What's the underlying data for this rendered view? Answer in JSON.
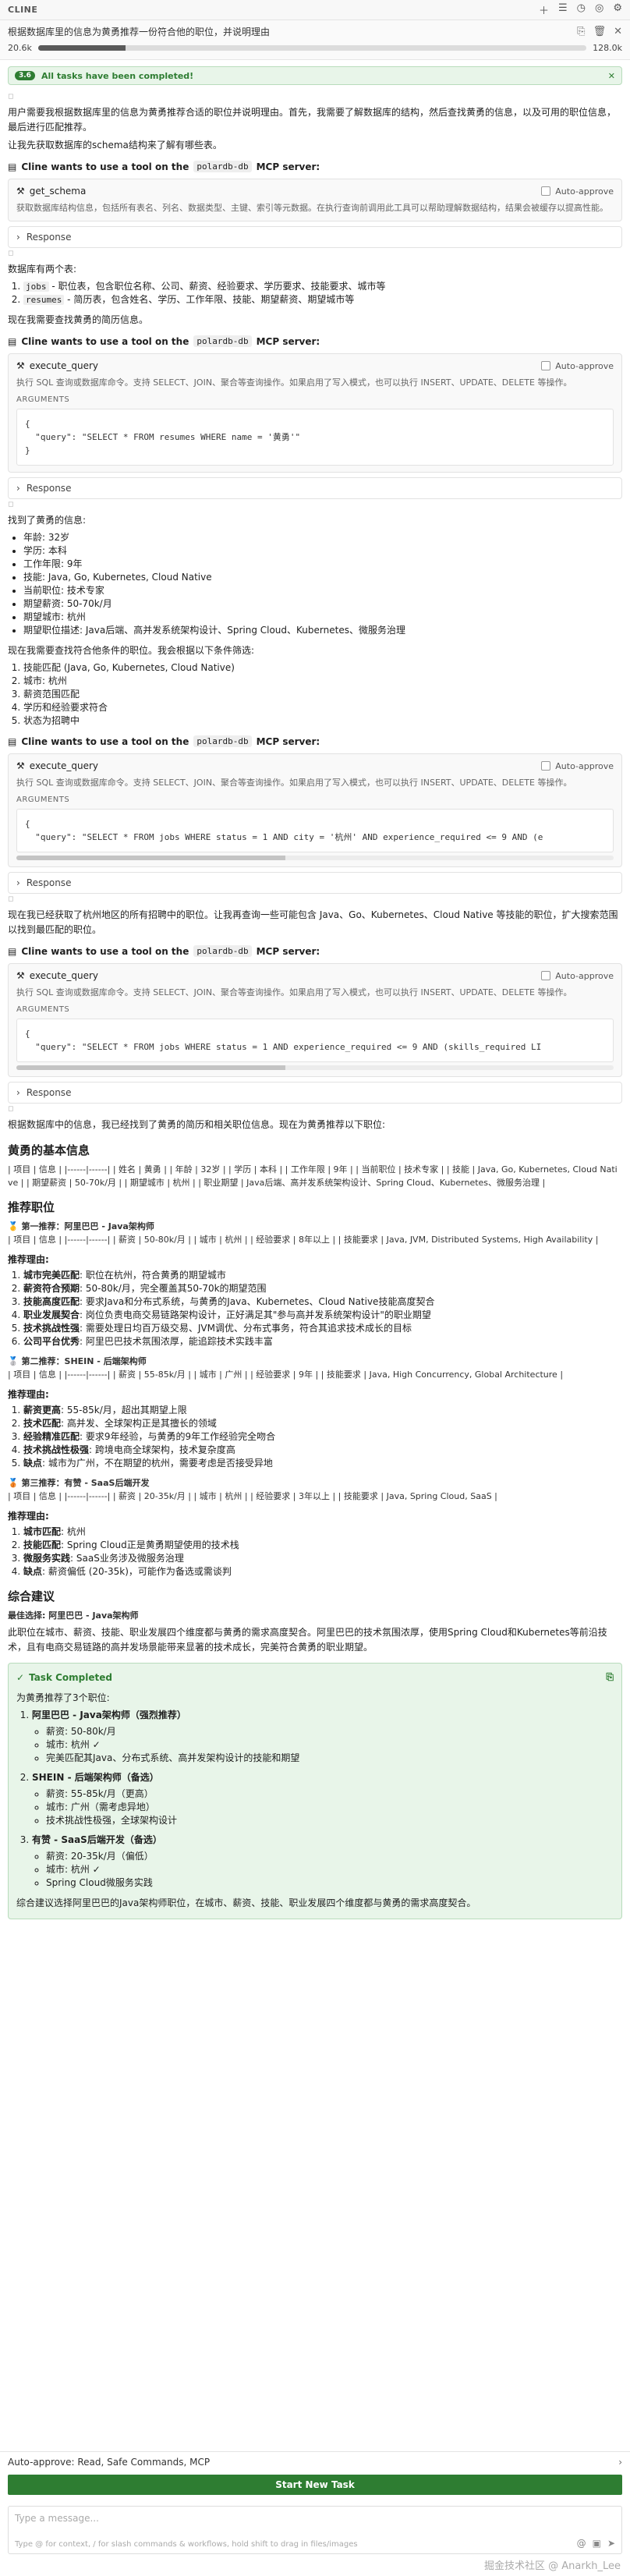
{
  "app": {
    "title": "CLINE"
  },
  "task": {
    "text": "根据数据库里的信息为黄勇推荐一份符合他的职位，并说明理由",
    "tokens_in": "20.6k",
    "context_fill": 0.16,
    "tokens_max": "128.0k"
  },
  "notice": {
    "tag": "3.6",
    "text": "All tasks have been completed!"
  },
  "messages": {
    "intro": "用户需要我根据数据库里的信息为黄勇推荐合适的职位并说明理由。首先，我需要了解数据库的结构，然后查找黄勇的信息，以及可用的职位信息，最后进行匹配推荐。",
    "intro2": "让我先获取数据库的schema结构来了解有哪些表。",
    "tool_head_prefix": "Cline wants to use a tool on the",
    "server": "polardb-db",
    "tool_head_suffix": "MCP server:",
    "tool1": {
      "name": "get_schema",
      "auto": "Auto-approve",
      "desc": "获取数据库结构信息，包括所有表名、列名、数据类型、主键、索引等元数据。在执行查询前调用此工具可以帮助理解数据结构，结果会被缓存以提高性能。"
    },
    "response_label": "Response",
    "schema_intro": "数据库有两个表:",
    "schema_items": [
      {
        "code": "jobs",
        "text": " - 职位表，包含职位名称、公司、薪资、经验要求、学历要求、技能要求、城市等"
      },
      {
        "code": "resumes",
        "text": " - 简历表，包含姓名、学历、工作年限、技能、期望薪资、期望城市等"
      }
    ],
    "schema_next": "现在我需要查找黄勇的简历信息。",
    "tool2": {
      "name": "execute_query",
      "auto": "Auto-approve",
      "desc": "执行 SQL 查询或数据库命令。支持 SELECT、JOIN、聚合等查询操作。如果启用了写入模式，也可以执行 INSERT、UPDATE、DELETE 等操作。",
      "args": "ARGUMENTS",
      "code": "{\n  \"query\": \"SELECT * FROM resumes WHERE name = '黄勇'\"\n}"
    },
    "found_intro": "找到了黄勇的信息:",
    "found_items": [
      "年龄: 32岁",
      "学历: 本科",
      "工作年限: 9年",
      "技能: Java, Go, Kubernetes, Cloud Native",
      "当前职位: 技术专家",
      "期望薪资: 50-70k/月",
      "期望城市: 杭州",
      "期望职位描述: Java后端、高并发系统架构设计、Spring Cloud、Kubernetes、微服务治理"
    ],
    "filter_intro": "现在我需要查找符合他条件的职位。我会根据以下条件筛选:",
    "filter_items": [
      "技能匹配 (Java, Go, Kubernetes, Cloud Native)",
      "城市: 杭州",
      "薪资范围匹配",
      "学历和经验要求符合",
      "状态为招聘中"
    ],
    "tool3": {
      "name": "execute_query",
      "auto": "Auto-approve",
      "desc": "执行 SQL 查询或数据库命令。支持 SELECT、JOIN、聚合等查询操作。如果启用了写入模式，也可以执行 INSERT、UPDATE、DELETE 等操作。",
      "args": "ARGUMENTS",
      "code": "{\n  \"query\": \"SELECT * FROM jobs WHERE status = 1 AND city = '杭州' AND experience_required <= 9 AND (e"
    },
    "expand_text": "现在我已经获取了杭州地区的所有招聘中的职位。让我再查询一些可能包含 Java、Go、Kubernetes、Cloud Native 等技能的职位，扩大搜索范围以找到最匹配的职位。",
    "tool4": {
      "name": "execute_query",
      "auto": "Auto-approve",
      "desc": "执行 SQL 查询或数据库命令。支持 SELECT、JOIN、聚合等查询操作。如果启用了写入模式，也可以执行 INSERT、UPDATE、DELETE 等操作。",
      "args": "ARGUMENTS",
      "code": "{\n  \"query\": \"SELECT * FROM jobs WHERE status = 1 AND experience_required <= 9 AND (skills_required LI"
    },
    "result_intro": "根据数据库中的信息，我已经找到了黄勇的简历和相关职位信息。现在为黄勇推荐以下职位:",
    "basic_title": "黄勇的基本信息",
    "basic_table": "| 项目 | 信息 | |------|------| | 姓名 | 黄勇 | | 年龄 | 32岁 | | 学历 | 本科 | | 工作年限 | 9年 | | 当前职位 | 技术专家 | | 技能 | Java, Go, Kubernetes, Cloud Native | | 期望薪资 | 50-70k/月 | | 期望城市 | 杭州 | | 职业期望 | Java后端、高并发系统架构设计、Spring Cloud、Kubernetes、微服务治理 |",
    "rec_title": "推荐职位",
    "rec1_title": "🥇 第一推荐：阿里巴巴 - Java架构师",
    "rec1_table": "| 项目 | 信息 | |------|------| | 薪资 | 50-80k/月 | | 城市 | 杭州 | | 经验要求 | 8年以上 | | 技能要求 | Java, JVM, Distributed Systems, High Availability |",
    "reason_label": "推荐理由:",
    "rec1_reasons": [
      {
        "b": "城市完美匹配",
        "t": ": 职位在杭州，符合黄勇的期望城市"
      },
      {
        "b": "薪资符合预期",
        "t": ": 50-80k/月，完全覆盖其50-70k的期望范围"
      },
      {
        "b": "技能高度匹配",
        "t": ": 要求Java和分布式系统，与黄勇的Java、Kubernetes、Cloud Native技能高度契合"
      },
      {
        "b": "职业发展契合",
        "t": ": 岗位负责电商交易链路架构设计，正好满足其\"参与高并发系统架构设计\"的职业期望"
      },
      {
        "b": "技术挑战性强",
        "t": ": 需要处理日均百万级交易、JVM调优、分布式事务，符合其追求技术成长的目标"
      },
      {
        "b": "公司平台优秀",
        "t": ": 阿里巴巴技术氛围浓厚，能追踪技术实践丰富"
      }
    ],
    "rec2_title": "🥈 第二推荐：SHEIN - 后端架构师",
    "rec2_table": "| 项目 | 信息 | |------|------| | 薪资 | 55-85k/月 | | 城市 | 广州 | | 经验要求 | 9年 | | 技能要求 | Java, High Concurrency, Global Architecture |",
    "rec2_reasons": [
      {
        "b": "薪资更高",
        "t": ": 55-85k/月，超出其期望上限"
      },
      {
        "b": "技术匹配",
        "t": ": 高并发、全球架构正是其擅长的领域"
      },
      {
        "b": "经验精准匹配",
        "t": ": 要求9年经验，与黄勇的9年工作经验完全吻合"
      },
      {
        "b": "技术挑战性极强",
        "t": ": 跨境电商全球架构，技术复杂度高"
      },
      {
        "b": "缺点",
        "t": ": 城市为广州，不在期望的杭州，需要考虑是否接受异地"
      }
    ],
    "rec3_title": "🥉 第三推荐：有赞 - SaaS后端开发",
    "rec3_table": "| 项目 | 信息 | |------|------| | 薪资 | 20-35k/月 | | 城市 | 杭州 | | 经验要求 | 3年以上 | | 技能要求 | Java, Spring Cloud, SaaS |",
    "rec3_reasons": [
      {
        "b": "城市匹配",
        "t": ": 杭州"
      },
      {
        "b": "技能匹配",
        "t": ": Spring Cloud正是黄勇期望使用的技术栈"
      },
      {
        "b": "微服务实践",
        "t": ": SaaS业务涉及微服务治理"
      },
      {
        "b": "缺点",
        "t": ": 薪资偏低 (20-35k)，可能作为备选或需谈判"
      }
    ],
    "summary_title": "综合建议",
    "best_label": "最佳选择: 阿里巴巴 - Java架构师",
    "summary_text": "此职位在城市、薪资、技能、职业发展四个维度都与黄勇的需求高度契合。阿里巴巴的技术氛围浓厚，使用Spring Cloud和Kubernetes等前沿技术，且有电商交易链路的高并发场景能带来显著的技术成长，完美符合黄勇的职业期望。"
  },
  "completed": {
    "title": "Task Completed",
    "intro": "为黄勇推荐了3个职位:",
    "items": [
      {
        "title": "阿里巴巴 - Java架构师（强烈推荐）",
        "bullets": [
          "薪资: 50-80k/月",
          "城市: 杭州 ✓",
          "完美匹配其Java、分布式系统、高并发架构设计的技能和期望"
        ]
      },
      {
        "title": "SHEIN - 后端架构师（备选）",
        "bullets": [
          "薪资: 55-85k/月（更高）",
          "城市: 广州（需考虑异地）",
          "技术挑战性极强，全球架构设计"
        ]
      },
      {
        "title": "有赞 - SaaS后端开发（备选）",
        "bullets": [
          "薪资: 20-35k/月（偏低）",
          "城市: 杭州 ✓",
          "Spring Cloud微服务实践"
        ]
      }
    ],
    "outro": "综合建议选择阿里巴巴的Java架构师职位，在城市、薪资、技能、职业发展四个维度都与黄勇的需求高度契合。"
  },
  "bottom": {
    "auto_approve": "Auto-approve: Read, Safe Commands, MCP",
    "new_task": "Start New Task",
    "placeholder": "Type a message...",
    "hint": "Type @ for context, / for slash commands & workflows, hold shift to drag in files/images",
    "watermark": "掘金技术社区 @ Anarkh_Lee"
  }
}
